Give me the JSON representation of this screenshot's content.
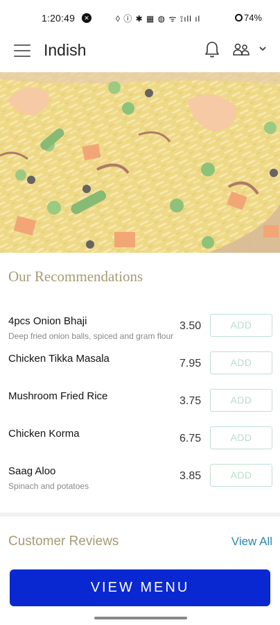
{
  "status_bar": {
    "time": "1:20:49",
    "indicators": "◊ ⓘ ✱ ▦ ◍ ᯤ ⟟ıll ıl",
    "battery": "74%"
  },
  "header": {
    "brand": "Indish",
    "icons": [
      "menu-icon",
      "bell-icon",
      "people-icon",
      "chevron-down-icon"
    ]
  },
  "hero": {
    "image": "vegetable fried rice"
  },
  "recommendations": {
    "title": "Our Recommendations",
    "add_label": "ADD",
    "items": [
      {
        "name": "4pcs Onion Bhaji",
        "description": "Deep fried onion balls, spiced and gram flour",
        "price": "3.50"
      },
      {
        "name": "Chicken Tikka Masala",
        "description": "",
        "price": "7.95"
      },
      {
        "name": "Mushroom Fried Rice",
        "description": "",
        "price": "3.75"
      },
      {
        "name": "Chicken Korma",
        "description": "",
        "price": "6.75"
      },
      {
        "name": "Saag Aloo",
        "description": "Spinach and potatoes",
        "price": "3.85"
      }
    ]
  },
  "reviews": {
    "title": "Customer Reviews",
    "view_all": "View All"
  },
  "cta": {
    "label": "VIEW MENU"
  },
  "colors": {
    "accent_gold": "#a89a74",
    "link_blue": "#2b86b3",
    "button_blue": "#0a28d2",
    "add_border": "#bfe0cf"
  }
}
